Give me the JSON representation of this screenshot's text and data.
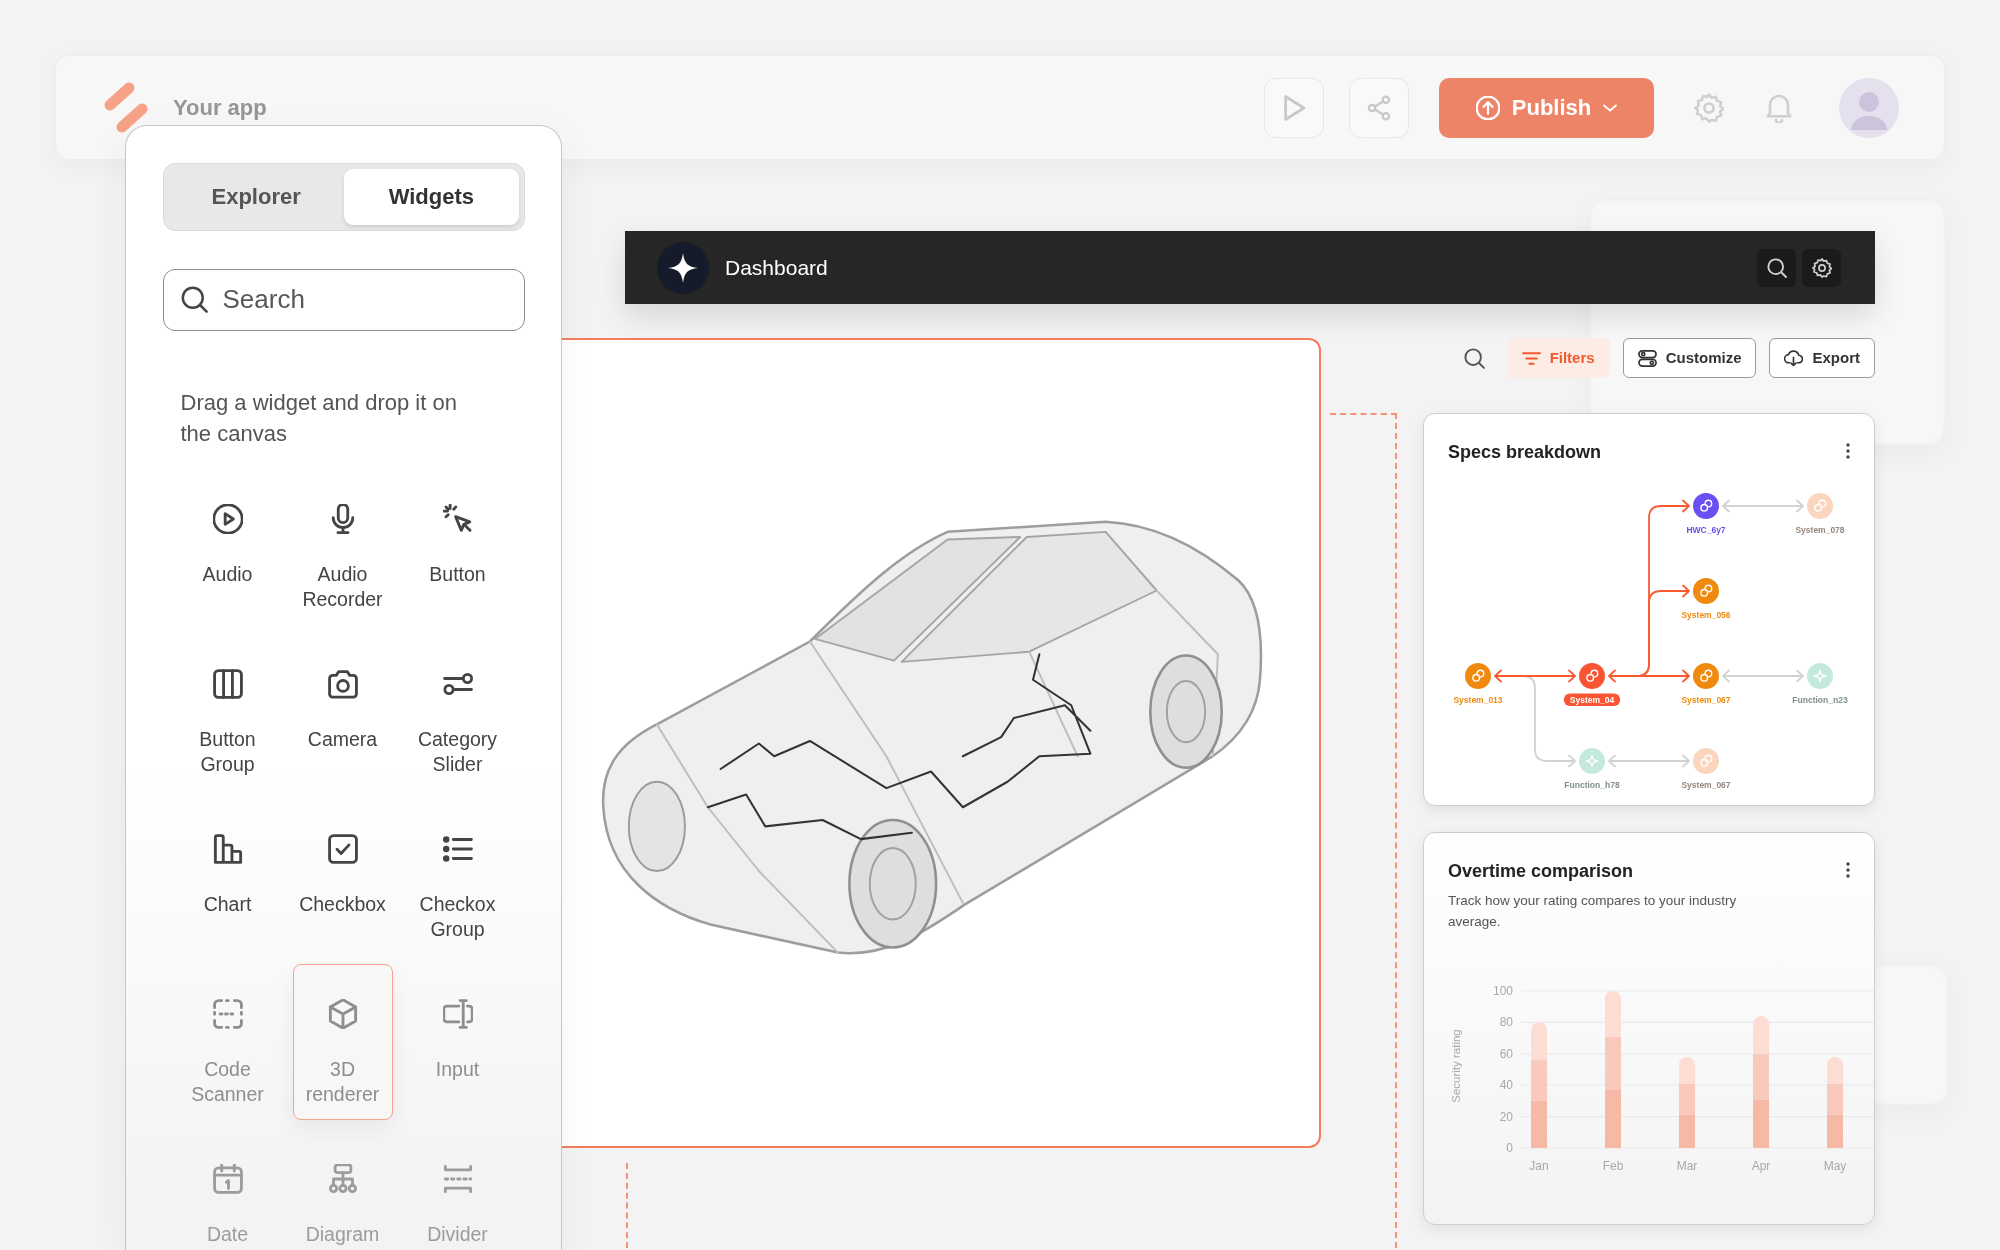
{
  "app_bar": {
    "title": "Your app",
    "publish_button": "Publish"
  },
  "widgets_panel": {
    "tabs": [
      {
        "label": "Explorer",
        "selected": false
      },
      {
        "label": "Widgets",
        "selected": true
      }
    ],
    "search": {
      "placeholder": "Search"
    },
    "hint": "Drag a widget and drop it on the canvas",
    "widgets": [
      {
        "label": "Audio",
        "selected": false
      },
      {
        "label": "Audio Recorder",
        "selected": false
      },
      {
        "label": "Button",
        "selected": false
      },
      {
        "label": "Button Group",
        "selected": false
      },
      {
        "label": "Camera",
        "selected": false
      },
      {
        "label": "Category Slider",
        "selected": false
      },
      {
        "label": "Chart",
        "selected": false
      },
      {
        "label": "Checkbox",
        "selected": false
      },
      {
        "label": "Checkox Group",
        "selected": false
      },
      {
        "label": "Code Scanner",
        "selected": false
      },
      {
        "label": "3D renderer",
        "selected": true
      },
      {
        "label": "Input",
        "selected": false
      },
      {
        "label": "Date",
        "selected": false
      },
      {
        "label": "Diagram",
        "selected": false
      },
      {
        "label": "Divider",
        "selected": false
      }
    ]
  },
  "dashboard": {
    "title": "Dashboard",
    "toolbar": [
      {
        "label": "Filters",
        "active": true
      },
      {
        "label": "Customize",
        "active": false
      },
      {
        "label": "Export",
        "active": false
      }
    ],
    "canvas_widget": {
      "highlighted": true
    },
    "specs_card": {
      "title": "Specs breakdown",
      "graph": {
        "root": {
          "label": "System_04",
          "kind": "system",
          "color": "#fa5533",
          "active": true,
          "selected": true,
          "children": [
            {
              "label": "System_013",
              "kind": "system",
              "color": "#ef8a0e",
              "active": true,
              "selected": false,
              "children": [
                {
                  "label": "Function_h78",
                  "kind": "function",
                  "color": "#c4e9df",
                  "active": false,
                  "selected": false,
                  "children": [
                    {
                      "label": "System_067",
                      "kind": "system",
                      "color": "#fbd5bd",
                      "active": false,
                      "selected": false
                    }
                  ]
                }
              ]
            },
            {
              "label": "HWC_6y7",
              "kind": "system",
              "color": "#6a4ff2",
              "active": true,
              "selected": false,
              "children": [
                {
                  "label": "System_078",
                  "kind": "system",
                  "color": "#fbd5bd",
                  "active": false,
                  "selected": false
                }
              ]
            },
            {
              "label": "System_056",
              "kind": "system",
              "color": "#ef8a0e",
              "active": true,
              "selected": false
            },
            {
              "label": "System_067",
              "kind": "system",
              "color": "#ef8a0e",
              "active": true,
              "selected": false,
              "children": [
                {
                  "label": "Function_n23",
                  "kind": "function",
                  "color": "#c4e9df",
                  "active": false,
                  "selected": false
                }
              ]
            }
          ]
        }
      }
    },
    "overtime_card": {
      "title": "Overtime comparison",
      "subtitle": "Track how your rating compares to your industry average.",
      "chart_data": {
        "type": "bar",
        "ylabel": "Security rating",
        "categories": [
          "Jan",
          "Feb",
          "Mar",
          "Apr",
          "May"
        ],
        "series": [
          {
            "color": "#f6b9a6",
            "values": [
              30,
              37,
              21,
              31,
              21
            ]
          },
          {
            "color": "#f9c9bb",
            "values": [
              26,
              34,
              20,
              29,
              20
            ]
          },
          {
            "color": "#fcdcd3",
            "values": [
              24,
              29,
              17,
              24,
              17
            ]
          }
        ],
        "stacked": true,
        "grid": true,
        "ylim": [
          0,
          100
        ],
        "yticks": [
          0,
          20,
          40,
          60,
          80,
          100
        ]
      }
    }
  }
}
